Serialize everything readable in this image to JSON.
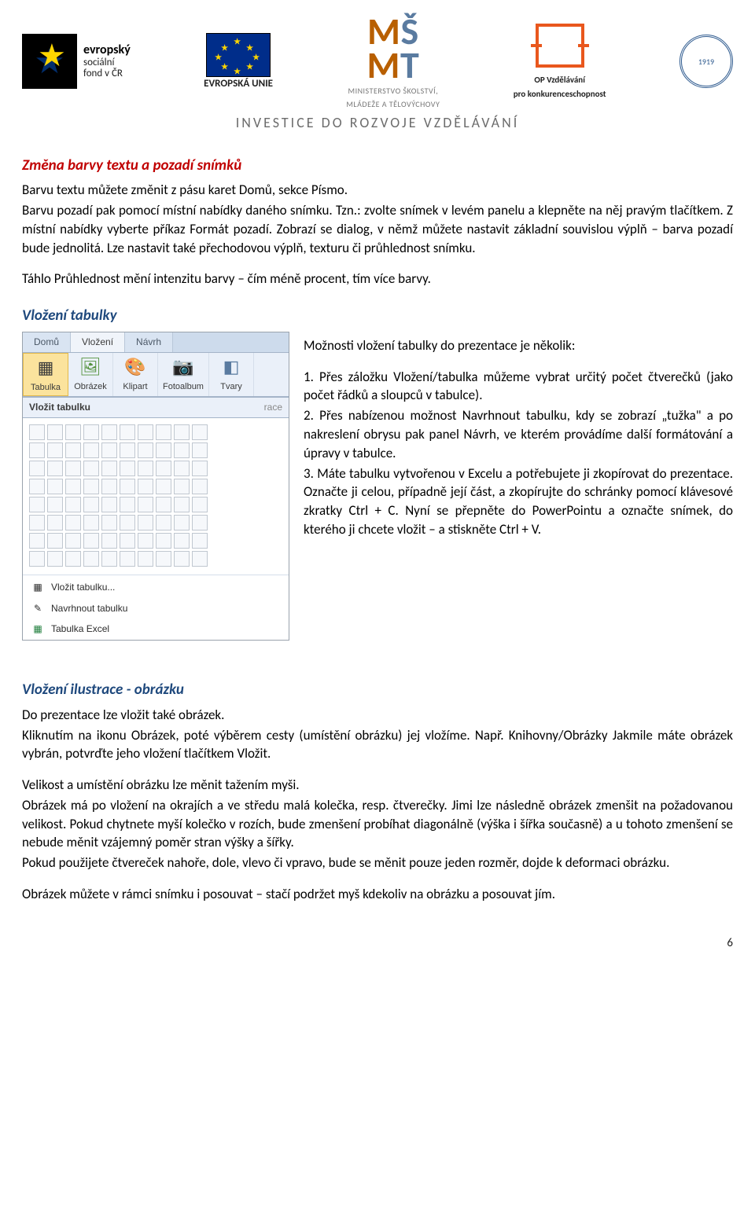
{
  "header": {
    "esf_bold": "evropský",
    "esf_sub1": "sociální",
    "esf_sub2": "fond v ČR",
    "eu_label": "EVROPSKÁ UNIE",
    "msmt_line1": "MINISTERSTVO ŠKOLSTVÍ,",
    "msmt_line2": "MLÁDEŽE A TĚLOVÝCHOVY",
    "op_line1": "OP Vzdělávání",
    "op_line2": "pro konkurenceschopnost",
    "seal_text": "1919",
    "invest": "INVESTICE DO ROZVOJE VZDĚLÁVÁNÍ"
  },
  "sect1_title": "Změna barvy textu a pozadí snímků",
  "sect1_p1": "Barvu textu můžete změnit z pásu karet Domů, sekce Písmo.",
  "sect1_p2": "Barvu pozadí pak pomocí místní nabídky daného snímku. Tzn.: zvolte snímek v levém panelu a klepněte na něj pravým tlačítkem. Z místní nabídky vyberte příkaz Formát pozadí. Zobrazí se dialog, v němž můžete nastavit základní souvislou výplň – barva pozadí bude jednolitá. Lze nastavit také přechodovou výplň, texturu či průhlednost snímku.",
  "sect1_p3": "Táhlo Průhlednost mění intenzitu barvy – čím méně procent, tím více barvy.",
  "sect2_title": "Vložení tabulky",
  "sect2_right_intro": "Možnosti vložení tabulky do prezentace je několik:",
  "sect2_right_1": "1. Přes záložku Vložení/tabulka můžeme vybrat určitý počet čtverečků (jako počet řádků a sloupců v tabulce).",
  "sect2_right_2": "2. Přes nabízenou možnost Navrhnout tabulku, kdy se zobrazí „tužka\" a po nakreslení obrysu pak panel Návrh, ve kterém provádíme další formátování a úpravy v tabulce.",
  "sect2_right_3": "3. Máte tabulku vytvořenou v Excelu a potřebujete ji zkopírovat do prezentace. Označte ji celou, případně její část, a zkopírujte do schránky pomocí klávesové zkratky Ctrl + C. Nyní se přepněte do PowerPointu a označte snímek, do kterého ji chcete vložit – a stiskněte Ctrl + V.",
  "ppt": {
    "tab1": "Domů",
    "tab2": "Vložení",
    "tab3": "Návrh",
    "btn_tabulka": "Tabulka",
    "btn_obrazek": "Obrázek",
    "btn_klipart": "Klipart",
    "btn_fotoalbum": "Fotoalbum",
    "btn_tvary": "Tvary",
    "drop_label": "Vložit tabulku",
    "drop_trail": "race",
    "menu_insert": "Vložit tabulku...",
    "menu_draw": "Navrhnout tabulku",
    "menu_excel": "Tabulka Excel"
  },
  "sect3_title": "Vložení ilustrace - obrázku",
  "sect3_p1": "Do prezentace lze vložit také obrázek.",
  "sect3_p2": "Kliknutím na ikonu Obrázek, poté výběrem cesty (umístění obrázku) jej vložíme. Např. Knihovny/Obrázky Jakmile máte obrázek vybrán, potvrďte jeho vložení tlačítkem Vložit.",
  "sect3_p3": "Velikost a umístění obrázku lze měnit tažením myši.",
  "sect3_p4": "Obrázek má po vložení na okrajích a ve středu malá kolečka, resp. čtverečky. Jimi lze následně obrázek zmenšit na požadovanou velikost. Pokud chytnete myší kolečko v rozích, bude zmenšení probíhat diagonálně (výška i šířka současně) a u tohoto zmenšení se nebude měnit vzájemný poměr stran výšky a šířky.",
  "sect3_p5": "Pokud použijete čtvereček nahoře, dole, vlevo či vpravo, bude se měnit pouze jeden rozměr, dojde k deformaci obrázku.",
  "sect3_p6": "Obrázek můžete v rámci snímku i posouvat – stačí podržet myš kdekoliv na obrázku a posouvat jím.",
  "page_number": "6"
}
